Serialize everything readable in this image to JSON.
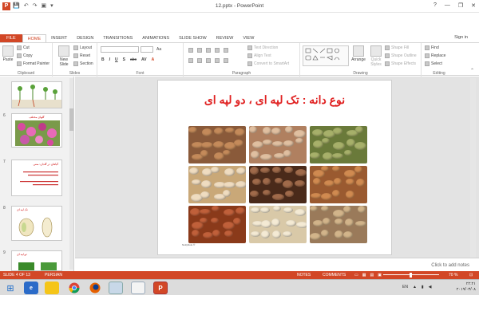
{
  "window": {
    "title": "12.pptx - PowerPoint",
    "help": "?",
    "min": "—",
    "restore": "❐",
    "close": "✕"
  },
  "qat": {
    "save": "💾",
    "undo": "↶",
    "redo": "↷",
    "present": "▣",
    "more": "▾"
  },
  "tabs": [
    {
      "label": "FILE"
    },
    {
      "label": "HOME"
    },
    {
      "label": "INSERT"
    },
    {
      "label": "DESIGN"
    },
    {
      "label": "TRANSITIONS"
    },
    {
      "label": "ANIMATIONS"
    },
    {
      "label": "SLIDE SHOW"
    },
    {
      "label": "REVIEW"
    },
    {
      "label": "VIEW"
    }
  ],
  "signin": "Sign in",
  "ribbon": {
    "clipboard": {
      "paste": "Paste",
      "cut": "Cut",
      "copy": "Copy",
      "format_painter": "Format Painter",
      "label": "Clipboard"
    },
    "slides": {
      "new_slide": "New Slide",
      "layout": "Layout",
      "reset": "Reset",
      "section": "Section",
      "label": "Slides"
    },
    "font": {
      "label": "Font",
      "bold": "B",
      "italic": "I",
      "underline": "U",
      "shadow": "S",
      "strike": "abc",
      "spacing": "AV",
      "case": "Aa",
      "color": "A"
    },
    "paragraph": {
      "text_direction": "Text Direction",
      "align_text": "Align Text",
      "convert_smartart": "Convert to SmartArt",
      "label": "Paragraph"
    },
    "drawing": {
      "arrange": "Arrange",
      "quick_styles": "Quick Styles",
      "shape_fill": "Shape Fill",
      "shape_outline": "Shape Outline",
      "shape_effects": "Shape Effects",
      "label": "Drawing"
    },
    "editing": {
      "find": "Find",
      "replace": "Replace",
      "select": "Select",
      "label": "Editing"
    }
  },
  "thumbnails": [
    {
      "number": "",
      "title": ""
    },
    {
      "number": "6",
      "title": "گلهای مختلف"
    },
    {
      "number": "7",
      "title": "گیاهان در گلدان: متنی"
    },
    {
      "number": "8",
      "title": "تک لپه ای"
    },
    {
      "number": "9",
      "title": "دو لپه ای"
    }
  ],
  "slide": {
    "title": "نوع دانه : تک لپه ای ، دو لپه ای",
    "caption": "NuttyNuts ®",
    "nuts": [
      {
        "name": "hazelnuts",
        "bg": "#8a5a3a",
        "dot": "#c48a5a"
      },
      {
        "name": "peanuts",
        "bg": "#b08060",
        "dot": "#e0bfa0"
      },
      {
        "name": "pistachios",
        "bg": "#6a7a3a",
        "dot": "#a7b06a"
      },
      {
        "name": "pine-nuts",
        "bg": "#c9a878",
        "dot": "#efdcc0"
      },
      {
        "name": "brazil-nuts",
        "bg": "#4a2a1a",
        "dot": "#a06a4a"
      },
      {
        "name": "almonds",
        "bg": "#9a5a30",
        "dot": "#d08a50"
      },
      {
        "name": "red-peanuts",
        "bg": "#8a3a1a",
        "dot": "#c0603a"
      },
      {
        "name": "cashews",
        "bg": "#d9c9a8",
        "dot": "#f4ead4"
      },
      {
        "name": "walnuts",
        "bg": "#9a7a5a",
        "dot": "#d2b48a"
      }
    ]
  },
  "notes_placeholder": "Click to add notes",
  "status": {
    "slide": "SLIDE 4 OF 13",
    "language": "PERSIAN",
    "notes": "NOTES",
    "comments": "COMMENTS",
    "zoom": "70 %",
    "fit": "⊡"
  },
  "taskbar": {
    "start": "⊞",
    "tray_lang": "EN",
    "time": "۲۲:۲۱",
    "date": "۲۰۱۹/۰۴/۰۸"
  }
}
